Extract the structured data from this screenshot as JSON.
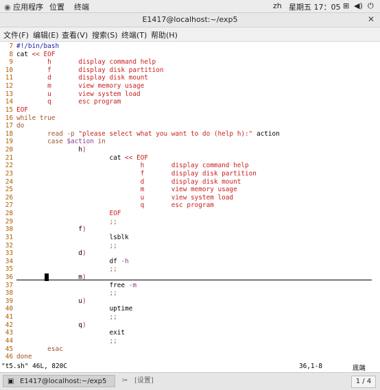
{
  "topbar": {
    "apps": "应用程序",
    "places": "位置",
    "terminal": "终端",
    "lang": "zh",
    "datetime": "星期五 17：05"
  },
  "window": {
    "title": "E1417@localhost:~/exp5",
    "close": "✕"
  },
  "menu": [
    "文件(F)",
    "编辑(E)",
    "查看(V)",
    "搜索(S)",
    "终端(T)",
    "帮助(H)"
  ],
  "lines": [
    {
      "n": "7",
      "segs": [
        {
          "t": "#!/bin/bash",
          "c": "#1a1aa6"
        }
      ]
    },
    {
      "n": "8",
      "segs": [
        {
          "t": "cat ",
          "c": "#000"
        },
        {
          "t": "<< EOF",
          "c": "#c81e1e"
        }
      ]
    },
    {
      "n": "9",
      "segs": [
        {
          "t": "        h       display command help",
          "c": "#c81e1e"
        }
      ]
    },
    {
      "n": "10",
      "segs": [
        {
          "t": "        f       display disk partition",
          "c": "#c81e1e"
        }
      ]
    },
    {
      "n": "11",
      "segs": [
        {
          "t": "        d       display disk mount",
          "c": "#c81e1e"
        }
      ]
    },
    {
      "n": "12",
      "segs": [
        {
          "t": "        m       view memory usage",
          "c": "#c81e1e"
        }
      ]
    },
    {
      "n": "13",
      "segs": [
        {
          "t": "        u       view system load",
          "c": "#c81e1e"
        }
      ]
    },
    {
      "n": "14",
      "segs": [
        {
          "t": "        q       esc program",
          "c": "#c81e1e"
        }
      ]
    },
    {
      "n": "15",
      "segs": [
        {
          "t": "EOF",
          "c": "#c81e1e"
        }
      ]
    },
    {
      "n": "16",
      "segs": [
        {
          "t": "while true",
          "c": "#a0522d"
        }
      ]
    },
    {
      "n": "17",
      "segs": [
        {
          "t": "do",
          "c": "#a0522d"
        }
      ]
    },
    {
      "n": "18",
      "segs": [
        {
          "t": "        read -p ",
          "c": "#a0522d"
        },
        {
          "t": "\"please select what you want to do (help h):\"",
          "c": "#c81e1e"
        },
        {
          "t": " action",
          "c": "#000"
        }
      ]
    },
    {
      "n": "19",
      "segs": [
        {
          "t": "        case ",
          "c": "#a0522d"
        },
        {
          "t": "$action",
          "c": "#8b3a8b"
        },
        {
          "t": " in",
          "c": "#a0522d"
        }
      ]
    },
    {
      "n": "20",
      "segs": [
        {
          "t": "                h",
          "c": "#000"
        },
        {
          "t": ")",
          "c": "#c81e1e"
        }
      ]
    },
    {
      "n": "21",
      "segs": [
        {
          "t": "                        cat ",
          "c": "#000"
        },
        {
          "t": "<< EOF",
          "c": "#c81e1e"
        }
      ]
    },
    {
      "n": "22",
      "segs": [
        {
          "t": "                                h       display command help",
          "c": "#c81e1e"
        }
      ]
    },
    {
      "n": "23",
      "segs": [
        {
          "t": "                                f       display disk partition",
          "c": "#c81e1e"
        }
      ]
    },
    {
      "n": "24",
      "segs": [
        {
          "t": "                                d       display disk mount",
          "c": "#c81e1e"
        }
      ]
    },
    {
      "n": "25",
      "segs": [
        {
          "t": "                                m       view memory usage",
          "c": "#c81e1e"
        }
      ]
    },
    {
      "n": "26",
      "segs": [
        {
          "t": "                                u       view system load",
          "c": "#c81e1e"
        }
      ]
    },
    {
      "n": "27",
      "segs": [
        {
          "t": "                                q       esc program",
          "c": "#c81e1e"
        }
      ]
    },
    {
      "n": "28",
      "segs": [
        {
          "t": "                        EOF",
          "c": "#c81e1e"
        }
      ]
    },
    {
      "n": "29",
      "segs": [
        {
          "t": "                        ;;",
          "c": "#a0522d"
        }
      ]
    },
    {
      "n": "30",
      "segs": [
        {
          "t": "                f",
          "c": "#000"
        },
        {
          "t": ")",
          "c": "#c81e1e"
        }
      ]
    },
    {
      "n": "31",
      "segs": [
        {
          "t": "                        lsblk",
          "c": "#000"
        }
      ]
    },
    {
      "n": "32",
      "segs": [
        {
          "t": "                        ;;",
          "c": "#a0522d"
        }
      ]
    },
    {
      "n": "33",
      "segs": [
        {
          "t": "                d",
          "c": "#000"
        },
        {
          "t": ")",
          "c": "#c81e1e"
        }
      ]
    },
    {
      "n": "34",
      "segs": [
        {
          "t": "                        df ",
          "c": "#000"
        },
        {
          "t": "-h",
          "c": "#8b3a8b"
        }
      ]
    },
    {
      "n": "35",
      "segs": [
        {
          "t": "                        ;;",
          "c": "#a0522d"
        }
      ]
    },
    {
      "n": "36",
      "segs": [
        {
          "t": "                m",
          "c": "#000"
        },
        {
          "t": ")",
          "c": "#c81e1e"
        }
      ]
    },
    {
      "n": "37",
      "segs": [
        {
          "t": "                        free ",
          "c": "#000"
        },
        {
          "t": "-m",
          "c": "#8b3a8b"
        }
      ]
    },
    {
      "n": "38",
      "segs": [
        {
          "t": "                        ;;",
          "c": "#a0522d"
        }
      ]
    },
    {
      "n": "39",
      "segs": [
        {
          "t": "                u",
          "c": "#000"
        },
        {
          "t": ")",
          "c": "#c81e1e"
        }
      ]
    },
    {
      "n": "40",
      "segs": [
        {
          "t": "                        uptime",
          "c": "#000"
        }
      ]
    },
    {
      "n": "41",
      "segs": [
        {
          "t": "                        ;;",
          "c": "#a0522d"
        }
      ]
    },
    {
      "n": "42",
      "segs": [
        {
          "t": "                q",
          "c": "#000"
        },
        {
          "t": ")",
          "c": "#c81e1e"
        }
      ]
    },
    {
      "n": "43",
      "segs": [
        {
          "t": "                        exit",
          "c": "#000"
        }
      ]
    },
    {
      "n": "44",
      "segs": [
        {
          "t": "                        ;;",
          "c": "#a0522d"
        }
      ]
    },
    {
      "n": "45",
      "segs": [
        {
          "t": "        esac",
          "c": "#a0522d"
        }
      ]
    },
    {
      "n": "46",
      "segs": [
        {
          "t": "done",
          "c": "#a0522d"
        }
      ]
    }
  ],
  "status": {
    "file": "\"t5.sh\" 46L, 820C",
    "pos": "36,1-8",
    "scroll": "底端"
  },
  "taskbar": {
    "task1": "E1417@localhost:~/exp5",
    "task2": "[设置]",
    "pager": "1 / 4"
  }
}
